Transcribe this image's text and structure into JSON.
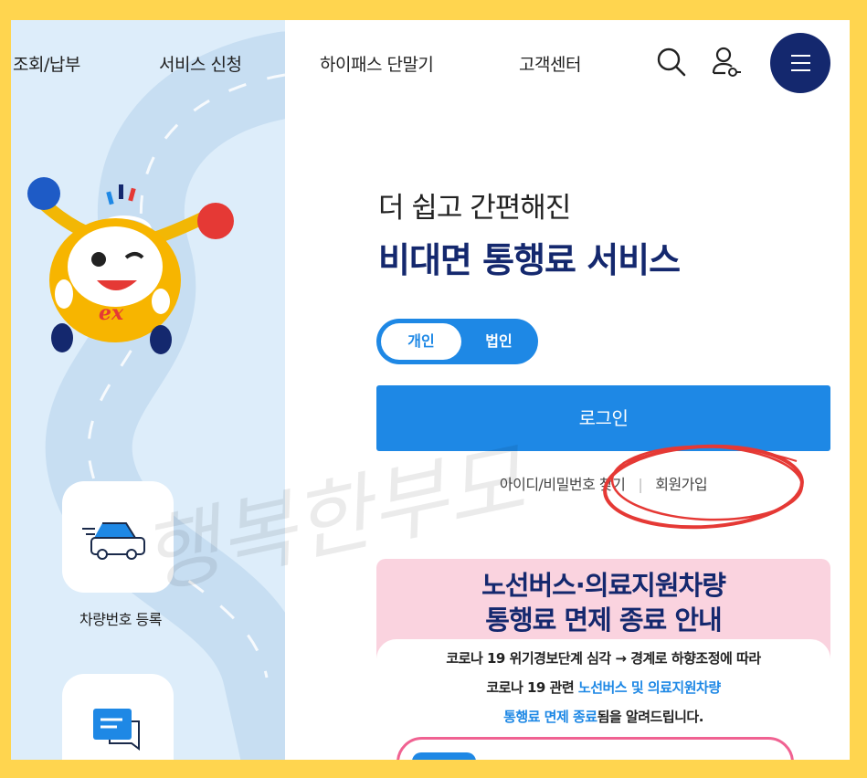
{
  "nav": {
    "items": [
      "조회/납부",
      "서비스 신청",
      "하이패스 단말기",
      "고객센터"
    ],
    "search_icon": "search-icon",
    "user_icon": "user-key-icon",
    "menu_icon": "hamburger-menu-icon"
  },
  "hero": {
    "subtitle": "더 쉽고 간편해진",
    "title": "비대면 통행료 서비스"
  },
  "member_toggle": {
    "options": [
      "개인",
      "법인"
    ],
    "selected": "개인"
  },
  "login": {
    "button_label": "로그인",
    "find_id_pw": "아이디/비밀번호 찾기",
    "separator": "|",
    "signup": "회원가입"
  },
  "quick_menu": {
    "items": [
      {
        "label": "차량번호 등록",
        "icon": "car-icon"
      },
      {
        "label": "",
        "icon": "chat-icon"
      }
    ]
  },
  "notice": {
    "headline_1": "노선버스·의료지원차량",
    "headline_2": "통행료 면제 종료 안내",
    "line_1": "코로나 19 위기경보단계 심각 → 경계로 하향조정에 따라",
    "line_2_prefix": "코로나 19 관련 ",
    "line_2_highlight": "노선버스 및 의료지원차량",
    "line_3_highlight": "통행료 면제 종료",
    "line_3_suffix": "됨을 알려드립니다."
  },
  "watermark": {
    "text": "행복한부모"
  },
  "colors": {
    "page_border": "#FFD54F",
    "left_panel": "#DDEDFA",
    "primary_blue": "#1E88E5",
    "navy": "#14286E",
    "notice_pink": "#FAD3DF",
    "annotation_red": "#E53935"
  }
}
